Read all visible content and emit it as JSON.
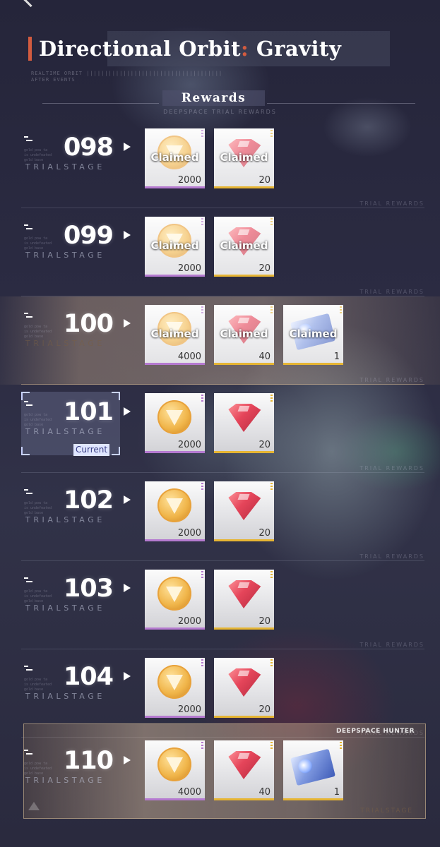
{
  "header": {
    "title_main": "Directional Orbit",
    "title_colon": ":",
    "title_suffix": " Gravity",
    "subtitle_line1": "REALTIME ORBIT |||||||||||||||||||||||||||||||||||||",
    "subtitle_line2": "AFTER EVENTS"
  },
  "rewards": {
    "label": "Rewards",
    "subtitle": "DEEPSPACE TRIAL REWARDS"
  },
  "stage_label": "TRIALSTAGE",
  "row_tag": "TRIAL REWARDS",
  "stage_faint_text": "gold pow ta is undefeated gold base",
  "current_label": "Current",
  "claimed_label": "Claimed",
  "brand": "DEEPSPACE HUNTER",
  "last_tag": "TRIALSTAGE",
  "rows": [
    {
      "stage": "098",
      "items": [
        {
          "type": "gold",
          "qty": "2000",
          "claimed": true
        },
        {
          "type": "gem",
          "qty": "20",
          "claimed": true
        }
      ]
    },
    {
      "stage": "099",
      "items": [
        {
          "type": "gold",
          "qty": "2000",
          "claimed": true
        },
        {
          "type": "gem",
          "qty": "20",
          "claimed": true
        }
      ]
    },
    {
      "stage": "100",
      "highlight": true,
      "items": [
        {
          "type": "gold",
          "qty": "4000",
          "claimed": true
        },
        {
          "type": "gem",
          "qty": "40",
          "claimed": true
        },
        {
          "type": "card",
          "qty": "1",
          "claimed": true
        }
      ]
    },
    {
      "stage": "101",
      "current": true,
      "items": [
        {
          "type": "gold",
          "qty": "2000",
          "claimed": false
        },
        {
          "type": "gem",
          "qty": "20",
          "claimed": false
        }
      ]
    },
    {
      "stage": "102",
      "items": [
        {
          "type": "gold",
          "qty": "2000",
          "claimed": false
        },
        {
          "type": "gem",
          "qty": "20",
          "claimed": false
        }
      ]
    },
    {
      "stage": "103",
      "items": [
        {
          "type": "gold",
          "qty": "2000",
          "claimed": false
        },
        {
          "type": "gem",
          "qty": "20",
          "claimed": false
        }
      ]
    },
    {
      "stage": "104",
      "items": [
        {
          "type": "gold",
          "qty": "2000",
          "claimed": false
        },
        {
          "type": "gem",
          "qty": "20",
          "claimed": false
        }
      ]
    },
    {
      "stage": "110",
      "milestone": true,
      "items": [
        {
          "type": "gold",
          "qty": "4000",
          "claimed": false
        },
        {
          "type": "gem",
          "qty": "40",
          "claimed": false
        },
        {
          "type": "card",
          "qty": "1",
          "claimed": false
        }
      ]
    }
  ],
  "colors": {
    "accent": "#d25b3f",
    "gold_rarity": "#b57ad0",
    "gem_rarity": "#e6b533",
    "current_bg": "#dfe6ff"
  }
}
